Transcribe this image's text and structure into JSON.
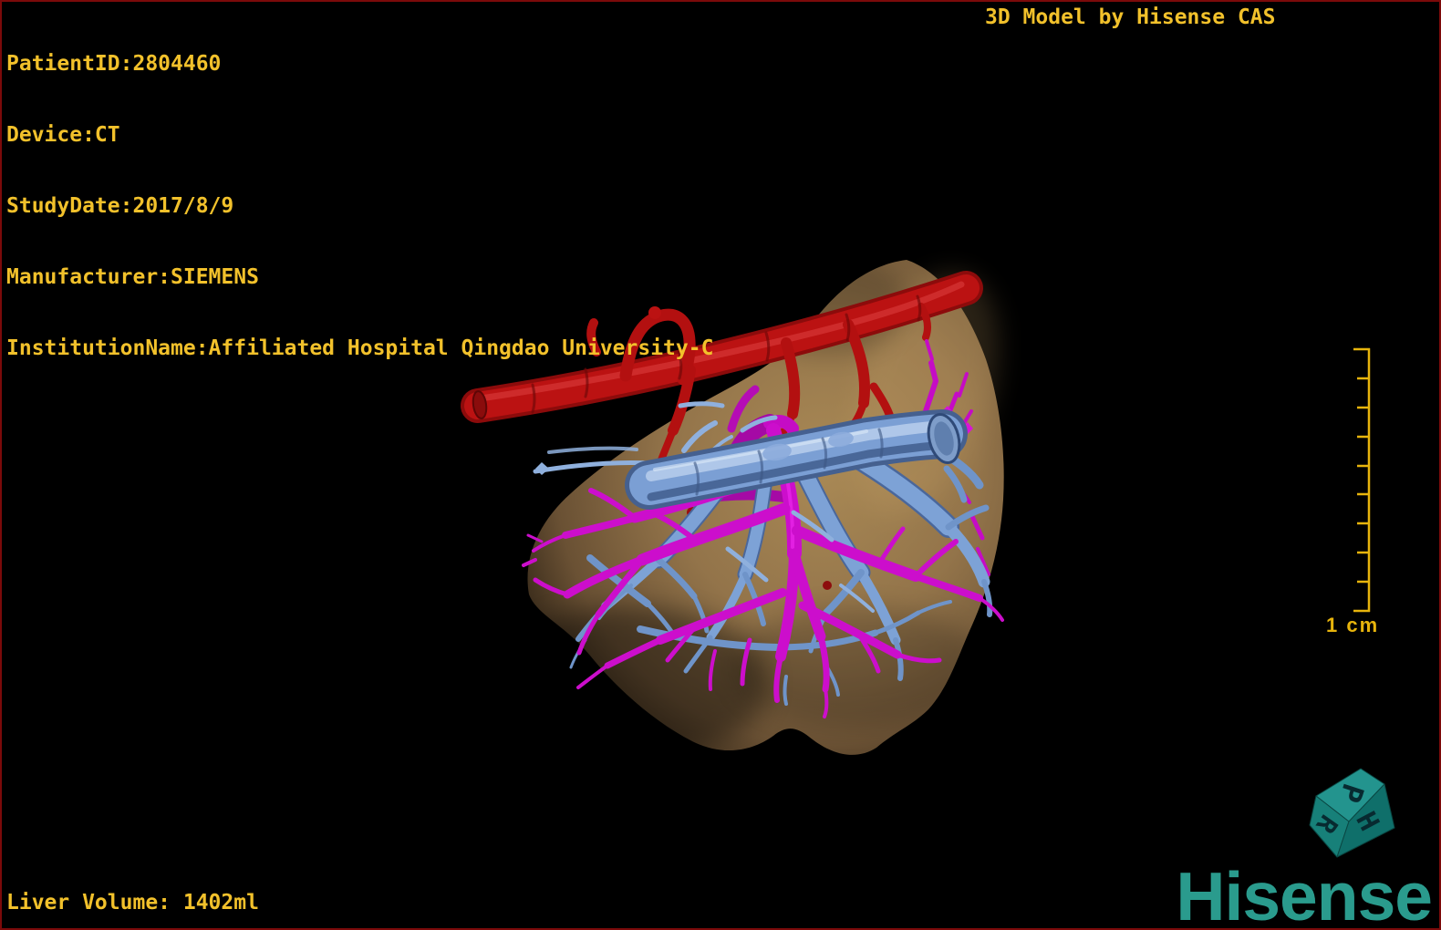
{
  "window": {
    "background_color": "#000000",
    "frame_border_color": "#7c0a0a"
  },
  "overlay": {
    "patient_info": [
      "PatientID:2804460",
      "Device:CT",
      "StudyDate:2017/8/9",
      "Manufacturer:SIEMENS",
      "InstitutionName:Affiliated Hospital Qingdao University-C"
    ],
    "watermark": "3D Model by Hisense CAS",
    "liver_volume": "Liver Volume: 1402ml",
    "text_color": "#f2c12b"
  },
  "scale_bar": {
    "label": "1 cm",
    "color": "#e7b40c",
    "divisions": 9
  },
  "orientation_cube": {
    "face_top": "P",
    "face_right": "H",
    "face_left": "R",
    "color": "#1f8c86"
  },
  "logo": {
    "text": "Hisense",
    "color": "#2a9b8d"
  },
  "model": {
    "liver_color": "#9a7a4d",
    "artery_color": "#b81111",
    "portal_vein_color": "#7b9fd4",
    "hepatic_vein_color": "#cc0ecc"
  }
}
